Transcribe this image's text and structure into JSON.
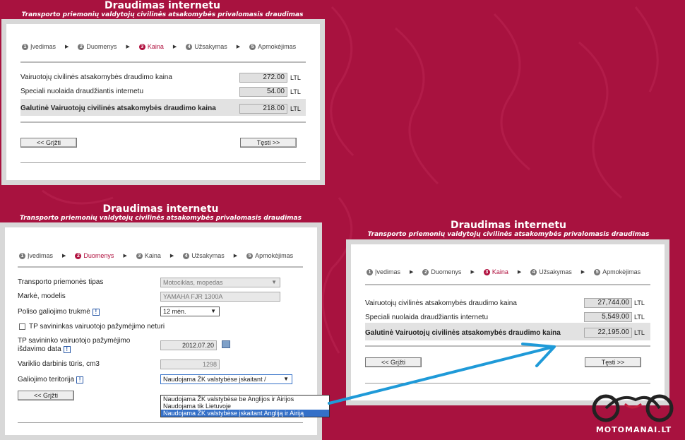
{
  "header": {
    "title": "Draudimas internetu",
    "subtitle": "Transporto priemonių valdytojų civilinės atsakomybės privalomasis draudimas"
  },
  "steps": [
    "Įvedimas",
    "Duomenys",
    "Kaina",
    "Užsakymas",
    "Apmokėjimas"
  ],
  "step_numbers": [
    "1",
    "2",
    "3",
    "4",
    "5"
  ],
  "price_rows": {
    "civil_label": "Vairuotojų civilinės atsakomybės draudimo kaina",
    "discount_label": "Speciali nuolaida draudžiantis internetu",
    "total_label": "Galutinė Vairuotojų civilinės atsakomybės draudimo kaina",
    "currency": "LTL"
  },
  "panel_top": {
    "civil": "272.00",
    "discount": "54.00",
    "total": "218.00"
  },
  "panel_right": {
    "civil": "27,744.00",
    "discount": "5,549.00",
    "total": "22,195.00"
  },
  "buttons": {
    "back": "<< Grįžti",
    "next": "Tęsti >>"
  },
  "form": {
    "vehicle_type_label": "Transporto priemonės tipas",
    "vehicle_type_value": "Motociklas, mopedas",
    "make_model_label": "Markė, modelis",
    "make_model_value": "YAMAHA FJR 1300A",
    "term_label": "Poliso galiojimo trukmė",
    "term_value": "12 mėn.",
    "no_license_label": "TP savininkas vairuotojo pažymėjimo neturi",
    "license_date_label_1": "TP savininko vairuotojo pažymėjimo",
    "license_date_label_2": "išdavimo data",
    "license_date_value": "2012.07.20",
    "engine_label": "Variklio darbinis tūris, cm3",
    "engine_value": "1298",
    "territory_label": "Galiojimo teritorija",
    "territory_value": "Naudojama ŽK valstybėse įskaitant /",
    "territory_options": [
      "Naudojama ŽK valstybėse be Anglijos ir Airijos",
      "Naudojama tik Lietuvoje",
      "Naudojama ŽK valstybėse įskaitant Angliją ir Airiją"
    ]
  },
  "logo": {
    "text": "MOTOMANAI.LT"
  },
  "colors": {
    "background": "#a8123f",
    "accent": "#b0103e",
    "arrow": "#1f9ad8"
  }
}
